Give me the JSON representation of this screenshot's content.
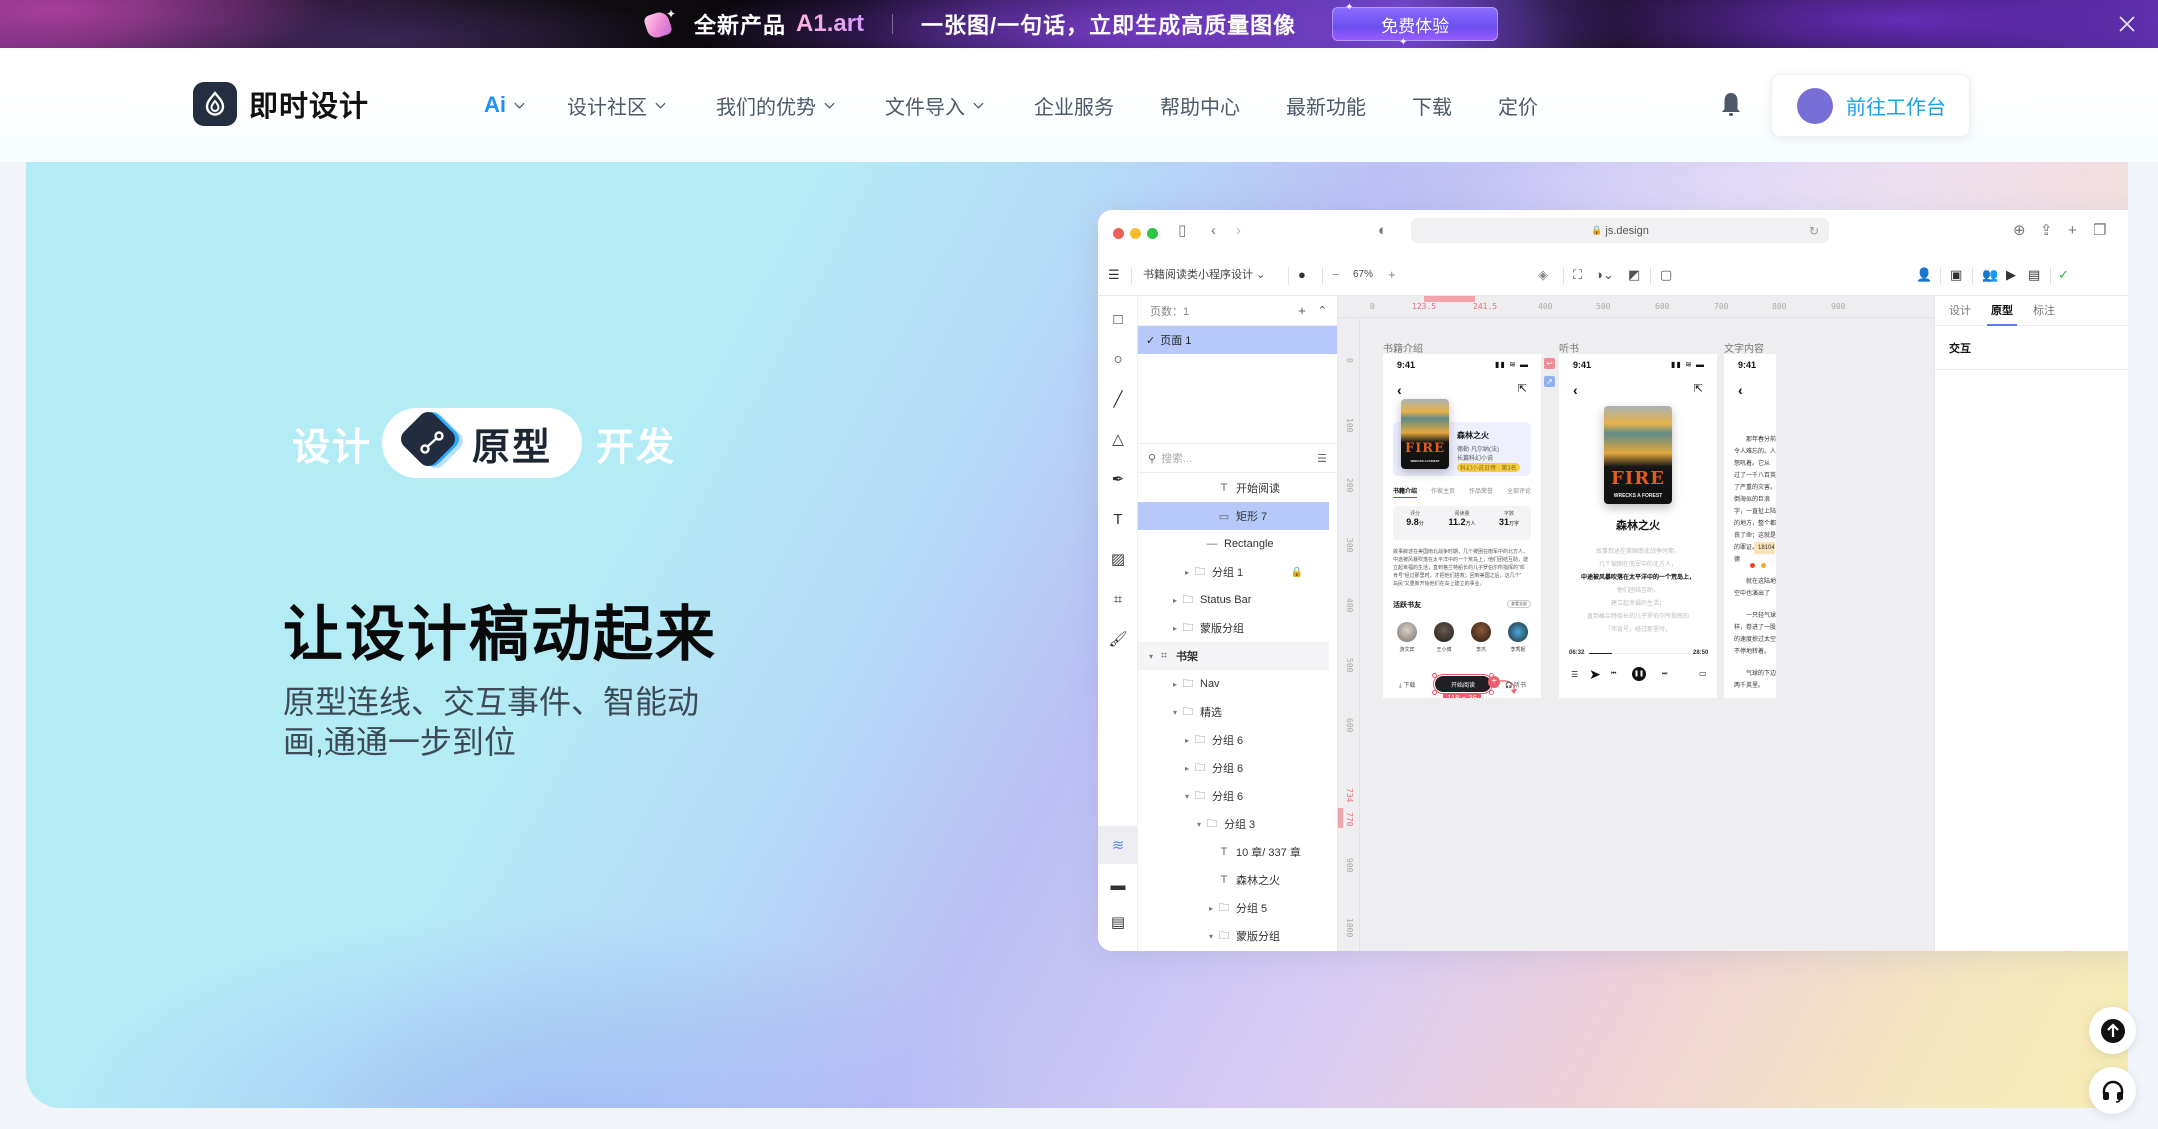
{
  "promo": {
    "title": "全新产品",
    "brand": "A1.art",
    "subtitle": "一张图/一句话，立即生成高质量图像",
    "cta_label": "免费体验",
    "close_icon": "close-icon"
  },
  "nav": {
    "logo_text": "即时设计",
    "menu": [
      {
        "label": "Ai",
        "has_dropdown": true,
        "active": true
      },
      {
        "label": "设计社区",
        "has_dropdown": true
      },
      {
        "label": "我们的优势",
        "has_dropdown": true
      },
      {
        "label": "文件导入",
        "has_dropdown": true
      },
      {
        "label": "企业服务",
        "has_dropdown": false
      },
      {
        "label": "帮助中心",
        "has_dropdown": false
      },
      {
        "label": "最新功能",
        "has_dropdown": false
      },
      {
        "label": "下载",
        "has_dropdown": false
      },
      {
        "label": "定价",
        "has_dropdown": false
      }
    ],
    "notification_icon": "bell-icon",
    "workbench_label": "前往工作台",
    "accent_color": "#1f9fe8"
  },
  "hero": {
    "pill_left": "设计",
    "pill_center": "原型",
    "pill_right": "开发",
    "title": "让设计稿动起来",
    "description": "原型连线、交互事件、智能动画,通通一步到位"
  },
  "mockup": {
    "url": "js.design",
    "file_name": "书籍阅读类小程序设计",
    "zoom": "67%",
    "pages_header": "页数：1",
    "page_name": "页面 1",
    "search_placeholder": "搜索...",
    "layers": [
      {
        "name": "开始阅读",
        "type": "text",
        "depth": 5
      },
      {
        "name": "矩形 7",
        "type": "rect",
        "depth": 5,
        "selected": true
      },
      {
        "name": "Rectangle",
        "type": "line",
        "depth": 4
      },
      {
        "name": "分组 1",
        "type": "group",
        "depth": 3,
        "locked": true,
        "collapsed": true
      },
      {
        "name": "Status Bar",
        "type": "group",
        "depth": 2,
        "collapsed": true
      },
      {
        "name": "蒙版分组",
        "type": "group",
        "depth": 2,
        "collapsed": true
      },
      {
        "name": "书架",
        "type": "frame",
        "depth": 0,
        "expanded": true
      },
      {
        "name": "Nav",
        "type": "group",
        "depth": 2,
        "collapsed": true
      },
      {
        "name": "精选",
        "type": "group",
        "depth": 2,
        "expanded": true
      },
      {
        "name": "分组 6",
        "type": "group",
        "depth": 3,
        "collapsed": true
      },
      {
        "name": "分组 6",
        "type": "group",
        "depth": 3,
        "collapsed": true
      },
      {
        "name": "分组 6",
        "type": "group",
        "depth": 3,
        "expanded": true
      },
      {
        "name": "分组 3",
        "type": "group",
        "depth": 4,
        "expanded": true
      },
      {
        "name": "10 章/ 337 章",
        "type": "text",
        "depth": 5
      },
      {
        "name": "森林之火",
        "type": "text",
        "depth": 5
      },
      {
        "name": "分组 5",
        "type": "group",
        "depth": 5,
        "collapsed": true
      },
      {
        "name": "蒙版分组",
        "type": "group",
        "depth": 5,
        "expanded": true
      }
    ],
    "ruler_top": [
      "0",
      "123.5",
      "241.5",
      "400",
      "500",
      "600",
      "700",
      "800",
      "900"
    ],
    "ruler_left": [
      "0",
      "100",
      "200",
      "300",
      "400",
      "500",
      "600",
      "734",
      "770",
      "900",
      "1000"
    ],
    "frames": {
      "intro": {
        "label": "书籍介绍",
        "time": "9:41",
        "book_title": "森林之火",
        "author": "德勒·凡尔纳(法)",
        "genre": "长篇科幻小说",
        "rank_badge": "科幻小说日榜 · 第3名",
        "cover_title": "FIRE",
        "cover_subtitle": "WRECKS A FOREST",
        "tabs": [
          "书籍介绍",
          "作家主页",
          "作品荣誉",
          "全部评论"
        ],
        "stats": [
          {
            "label": "评分",
            "value": "9.8",
            "unit": "分"
          },
          {
            "label": "阅读量",
            "value": "11.2",
            "unit": "万人"
          },
          {
            "label": "字数",
            "value": "31",
            "unit": "万字"
          }
        ],
        "summary": [
          "故事叙述在美国南北战争时期，几个被困在南军中的北方人，",
          "中途被风暴吹落在太平洋中的一个荒岛上，他们团结互助，建",
          "立起幸福的生活；直到格兰特船长的儿子罗伯尔所指挥的“邓",
          "肯号”经过那里时，才把他们搭救；回到美国之后，这几个“",
          "岛民”又重新开始他们在岛上建立的事业。"
        ],
        "friends_title": "活跃书友",
        "see_all": "查看全部",
        "friends": [
          "游文宾",
          "王小博",
          "李杰",
          "李秀妮"
        ],
        "download_label": "下载",
        "start_label": "开始阅读",
        "listen_label": "听书",
        "dimension_badge": "118 x 36"
      },
      "listen": {
        "label": "听书",
        "time": "9:41",
        "book_title": "森林之火",
        "lyrics": [
          {
            "text": "故事叙述在美国南北战争时期，",
            "current": false
          },
          {
            "text": "几个被困在南军中的北方人，",
            "current": false
          },
          {
            "text": "中途被风暴吹落在太平洋中的一个荒岛上，",
            "current": true
          },
          {
            "text": "他们团结互助，",
            "current": false
          },
          {
            "text": "建立起幸福的生活；",
            "current": false
          },
          {
            "text": "直到格兰特船长的儿子罗伯尔所指挥的",
            "current": false
          },
          {
            "text": "「邓肯号」经过那里时，",
            "current": false
          }
        ],
        "elapsed": "06:32",
        "duration": "28:50",
        "progress": 0.227
      },
      "reading": {
        "label": "文字内容",
        "time": "9:41",
        "lines": [
          "那年春分前",
          "令人难忘的。人",
          "怒吼着。它从",
          "过了一千八百英",
          "了严重的灾害。",
          "倒海似的巨浪",
          "字，一直扯上陆",
          "的地方，整个都",
          "丧了命；这就是",
          "的罪证。18104",
          "德",
          "就在这陆地",
          "空中也演出了",
          "一只轻气球",
          "样，卷进了一股",
          "的速度掠过太空",
          "不停地转着。",
          "气球的下边",
          "两千英里。"
        ]
      }
    },
    "props_tabs": [
      {
        "label": "设计",
        "active": false
      },
      {
        "label": "原型",
        "active": true
      },
      {
        "label": "标注",
        "active": false
      }
    ],
    "interaction_label": "交互"
  },
  "floating": {
    "back_to_top_icon": "arrow-up-icon",
    "support_icon": "headset-icon"
  }
}
